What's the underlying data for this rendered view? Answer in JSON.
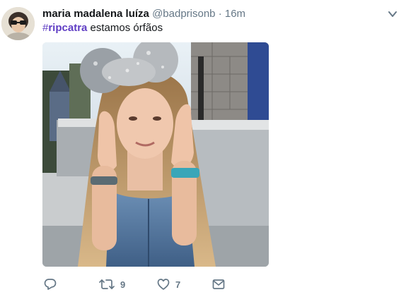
{
  "tweet": {
    "display_name": "maria madalena luíza",
    "handle": "@badprisonb",
    "separator": "·",
    "time": "16m",
    "hashtag_symbol": "#",
    "hashtag_word": "ripcatra",
    "text": " estamos órfãos",
    "retweets": "9",
    "likes": "7"
  },
  "icons": {
    "menu": "chevron-down-icon",
    "reply": "reply-icon",
    "retweet": "retweet-icon",
    "like": "heart-icon",
    "message": "envelope-icon"
  },
  "colors": {
    "hashtag": "#5f3dc4",
    "muted": "#657786",
    "text": "#14171a"
  }
}
